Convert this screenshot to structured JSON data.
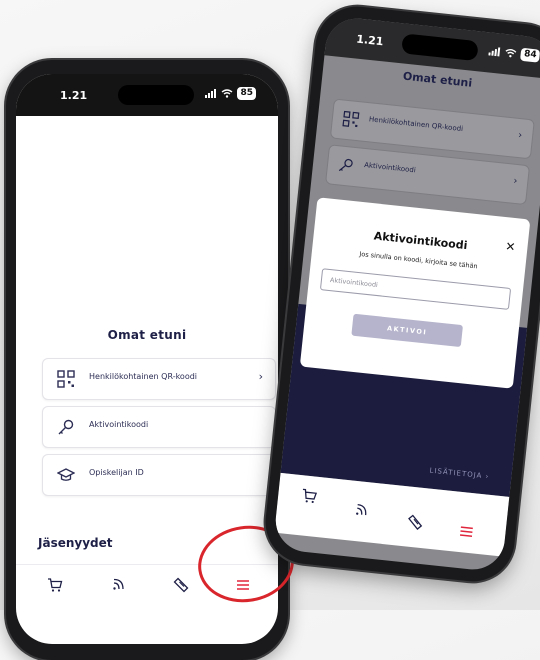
{
  "colors": {
    "brand_navy": "#1f2047",
    "dark_panel": "#1c1d3e",
    "menu_red": "#e0263c",
    "annotation_red": "#d9262c",
    "button_disabled": "#b5b4cc"
  },
  "left_phone": {
    "status": {
      "time": "1.21",
      "battery": "85"
    },
    "page_title": "Omat etuni",
    "menu_items": [
      {
        "label": "Henkilökohtainen QR-koodi",
        "icon": "qr-code-icon",
        "chevron": "›"
      },
      {
        "label": "Aktivointikoodi",
        "icon": "key-icon"
      },
      {
        "label": "Opiskelijan ID",
        "icon": "graduation-cap-icon"
      }
    ],
    "section_title": "Jäsenyydet",
    "tabbar": [
      "cart-icon",
      "nfc-icon",
      "ticket-icon",
      "menu-icon"
    ]
  },
  "right_phone": {
    "status": {
      "time": "1.21",
      "battery": "84"
    },
    "page_title": "Omat etuni",
    "menu_items": [
      {
        "label": "Henkilökohtainen QR-koodi",
        "icon": "qr-code-icon",
        "chevron": "›"
      },
      {
        "label": "Aktivointikoodi",
        "icon": "key-icon",
        "chevron": "›"
      }
    ],
    "modal": {
      "title": "Aktivointikoodi",
      "close": "✕",
      "description": "Jos sinulla on koodi, kirjoita se tähän",
      "input_placeholder": "Aktivointikoodi",
      "button_label": "AKTIVOI"
    },
    "more_link": "LISÄTIETOJA ›",
    "tabbar": [
      "cart-icon",
      "nfc-icon",
      "ticket-icon",
      "menu-icon"
    ]
  }
}
